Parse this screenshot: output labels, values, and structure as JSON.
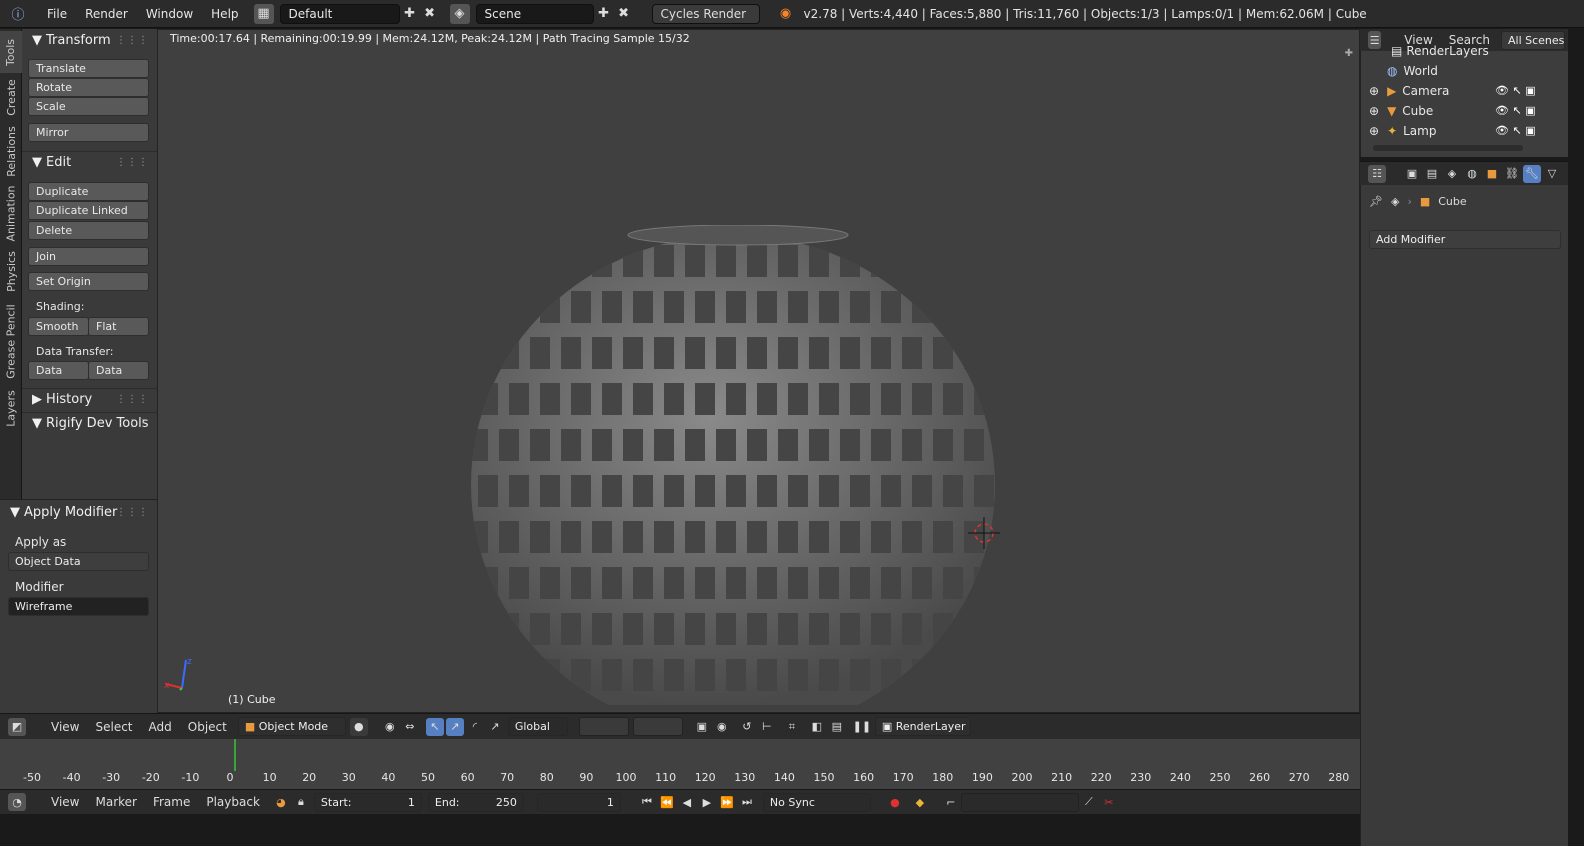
{
  "topbar": {
    "menus": [
      "File",
      "Render",
      "Window",
      "Help"
    ],
    "screen_layout": "Default",
    "scene": "Scene",
    "render_engine": "Cycles Render",
    "stats": "v2.78 | Verts:4,440 | Faces:5,880 | Tris:11,760 | Objects:1/3 | Lamps:0/1 | Mem:62.06M | Cube"
  },
  "tool_tabs": [
    "Tools",
    "Create",
    "Relations",
    "Animation",
    "Physics",
    "Grease Pencil",
    "Layers"
  ],
  "tools": {
    "transform": {
      "title": "Transform",
      "buttons": [
        "Translate",
        "Rotate",
        "Scale",
        "Mirror"
      ]
    },
    "edit": {
      "title": "Edit",
      "buttons": [
        "Duplicate",
        "Duplicate Linked",
        "Delete",
        "Join",
        "Set Origin"
      ],
      "shading_label": "Shading:",
      "shading": [
        "Smooth",
        "Flat"
      ],
      "data_transfer_label": "Data Transfer:",
      "data_transfer": [
        "Data",
        "Data Layo"
      ]
    },
    "history": "History",
    "rigify": "Rigify Dev Tools"
  },
  "operator": {
    "title": "Apply Modifier",
    "apply_as_label": "Apply as",
    "apply_as": "Object Data",
    "modifier_label": "Modifier",
    "modifier": "Wireframe"
  },
  "viewport": {
    "status": "Time:00:17.64 | Remaining:00:19.99 | Mem:24.12M, Peak:24.12M | Path Tracing Sample 15/32",
    "object_label": "(1) Cube"
  },
  "view3d_header": {
    "menus": [
      "View",
      "Select",
      "Add",
      "Object"
    ],
    "mode": "Object Mode",
    "orientation": "Global",
    "render_layer": "RenderLayer"
  },
  "timeline": {
    "ticks": [
      "-50",
      "-40",
      "-30",
      "-20",
      "-10",
      "0",
      "10",
      "20",
      "30",
      "40",
      "50",
      "60",
      "70",
      "80",
      "90",
      "100",
      "110",
      "120",
      "130",
      "140",
      "150",
      "160",
      "170",
      "180",
      "190",
      "200",
      "210",
      "220",
      "230",
      "240",
      "250",
      "260",
      "270",
      "280"
    ],
    "current_frame": 1
  },
  "timeline_header": {
    "menus": [
      "View",
      "Marker",
      "Frame",
      "Playback"
    ],
    "start_label": "Start:",
    "start": "1",
    "end_label": "End:",
    "end": "250",
    "current": "1",
    "sync": "No Sync"
  },
  "outliner": {
    "header": [
      "View",
      "Search",
      "All Scenes"
    ],
    "partial_item": "RenderLayers",
    "items": [
      "World",
      "Camera",
      "Cube",
      "Lamp"
    ]
  },
  "properties": {
    "breadcrumb_object": "Cube",
    "add_modifier": "Add Modifier"
  }
}
